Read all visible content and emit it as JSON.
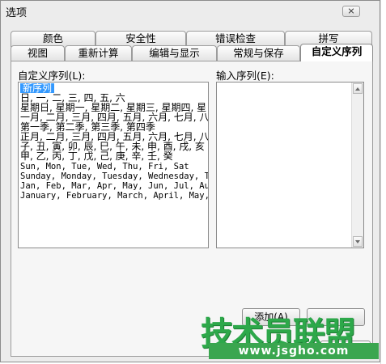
{
  "window": {
    "title": "选项"
  },
  "tabs_back": [
    "颜色",
    "安全性",
    "错误检查",
    "拼写"
  ],
  "tabs_front": [
    "视图",
    "重新计算",
    "编辑与显示",
    "常规与保存",
    "自定义序列"
  ],
  "active_tab": "自定义序列",
  "custom_lists": {
    "label": "自定义序列(L):",
    "items": [
      "新序列",
      "日, 一, 二, 三, 四, 五, 六",
      "星期日, 星期一, 星期二, 星期三, 星期四, 星",
      "一月, 二月, 三月, 四月, 五月, 六月, 七月, 八",
      "第一季, 第二季, 第三季, 第四季",
      "正月, 二月, 三月, 四月, 五月, 六月, 七月, 八",
      "子, 丑, 寅, 卯, 辰, 巳, 午, 未, 申, 酉, 戌, 亥",
      "甲, 乙, 丙, 丁, 戊, 己, 庚, 辛, 壬, 癸",
      "Sun, Mon, Tue, Wed, Thu, Fri, Sat",
      "Sunday, Monday, Tuesday, Wednesday, Thursday,",
      "Jan, Feb, Mar, Apr, May, Jun, Jul, Aug, Sep,",
      "January, February, March, April, May, June,"
    ],
    "selected_index": 0
  },
  "input_list": {
    "label": "输入序列(E):",
    "value": ""
  },
  "buttons": {
    "add": "添加(A)"
  },
  "watermark": {
    "brand": "技术员联盟",
    "url": "www.jsgho.com"
  }
}
